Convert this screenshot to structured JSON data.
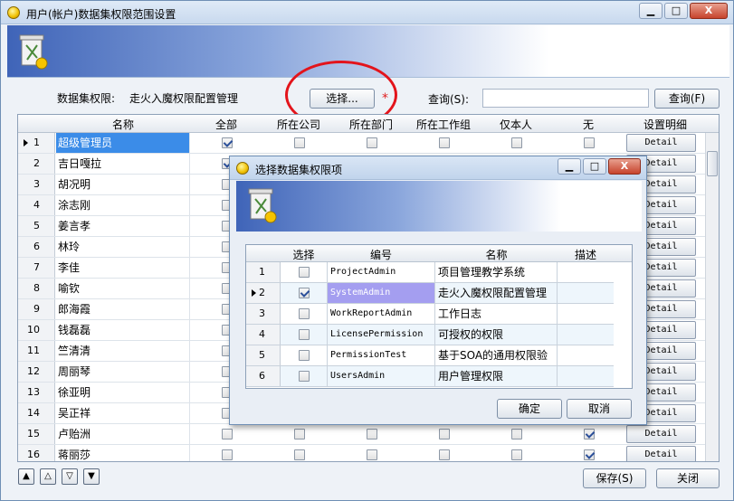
{
  "window": {
    "title": "用户(帐户)数据集权限范围设置",
    "min": "▁",
    "max": "□",
    "close": "X"
  },
  "filter": {
    "label": "数据集权限:",
    "value": "走火入魔权限配置管理",
    "select_btn": "选择...",
    "required": "*",
    "query_label": "查询(S):",
    "query_value": "",
    "query_btn": "查询(F)"
  },
  "grid": {
    "columns": [
      "名称",
      "全部",
      "所在公司",
      "所在部门",
      "所在工作组",
      "仅本人",
      "无",
      "设置明细"
    ],
    "detail_label": "Detail",
    "rows": [
      {
        "n": "1",
        "name": "超级管理员",
        "all": true,
        "none": false
      },
      {
        "n": "2",
        "name": "吉日嘎拉",
        "all": true,
        "none": false
      },
      {
        "n": "3",
        "name": "胡况明",
        "all": false,
        "none": false
      },
      {
        "n": "4",
        "name": "涂志刚",
        "all": false,
        "none": false
      },
      {
        "n": "5",
        "name": "姜言孝",
        "all": false,
        "none": false
      },
      {
        "n": "6",
        "name": "林玲",
        "all": false,
        "none": false
      },
      {
        "n": "7",
        "name": "李佳",
        "all": false,
        "none": false
      },
      {
        "n": "8",
        "name": "喻钦",
        "all": false,
        "none": false
      },
      {
        "n": "9",
        "name": "郎海霞",
        "all": false,
        "none": false
      },
      {
        "n": "10",
        "name": "钱磊磊",
        "all": false,
        "none": false
      },
      {
        "n": "11",
        "name": "竺清清",
        "all": false,
        "none": false
      },
      {
        "n": "12",
        "name": "周丽琴",
        "all": false,
        "none": false
      },
      {
        "n": "13",
        "name": "徐亚明",
        "all": false,
        "none": false
      },
      {
        "n": "14",
        "name": "吴正祥",
        "all": false,
        "none": false
      },
      {
        "n": "15",
        "name": "卢贻洲",
        "all": false,
        "none": true
      },
      {
        "n": "16",
        "name": "蒋丽莎",
        "all": false,
        "none": true
      }
    ]
  },
  "footer": {
    "nav": [
      "▲",
      "△",
      "▽",
      "▼"
    ],
    "save": "保存(S)",
    "close": "关闭"
  },
  "dialog": {
    "title": "选择数据集权限项",
    "columns": [
      "选择",
      "编号",
      "名称",
      "描述"
    ],
    "rows": [
      {
        "n": "1",
        "checked": false,
        "code": "ProjectAdmin",
        "name": "项目管理教学系统"
      },
      {
        "n": "2",
        "checked": true,
        "code": "SystemAdmin",
        "name": "走火入魔权限配置管理"
      },
      {
        "n": "3",
        "checked": false,
        "code": "WorkReportAdmin",
        "name": "工作日志"
      },
      {
        "n": "4",
        "checked": false,
        "code": "LicensePermission",
        "name": "可授权的权限"
      },
      {
        "n": "5",
        "checked": false,
        "code": "PermissionTest",
        "name": "基于SOA的通用权限验证"
      },
      {
        "n": "6",
        "checked": false,
        "code": "UsersAdmin",
        "name": "用户管理权限"
      }
    ],
    "ok": "确定",
    "cancel": "取消"
  }
}
